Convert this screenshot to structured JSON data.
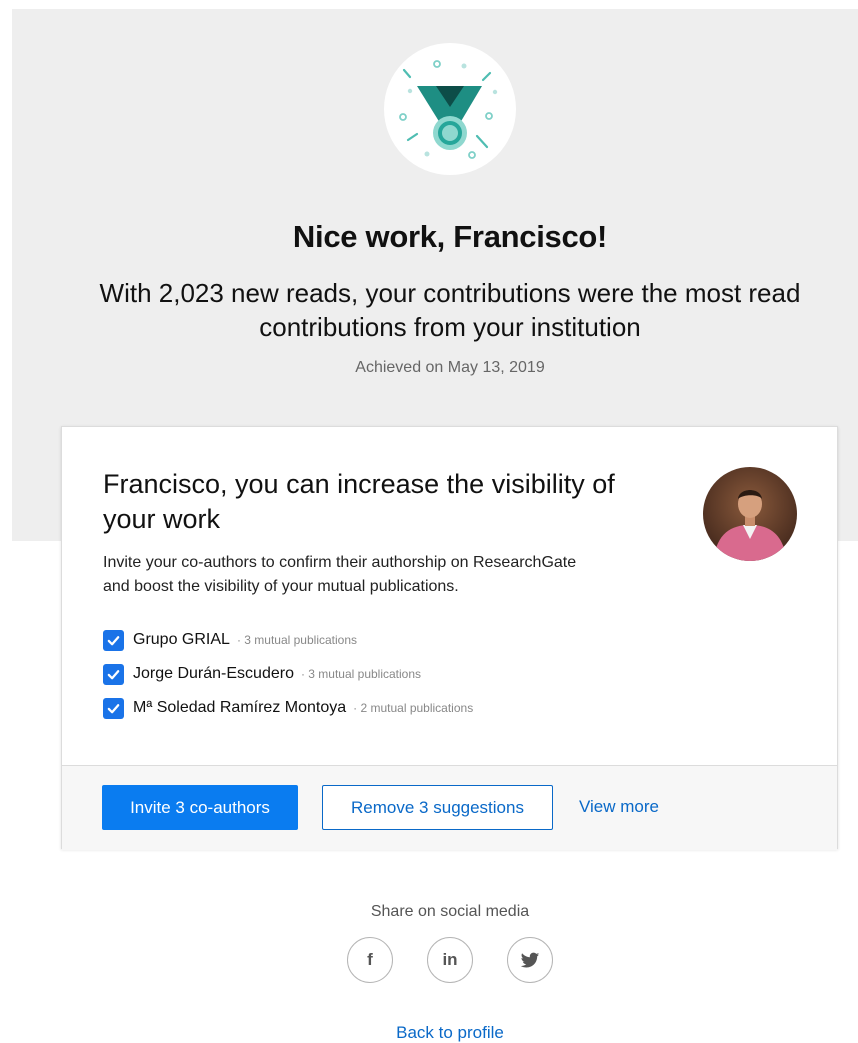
{
  "hero": {
    "headline": "Nice work, Francisco!",
    "subline_line1": "With 2,023 new reads, your contributions were the most read",
    "subline_line2": "contributions from your institution",
    "achieved": "Achieved on May 13, 2019"
  },
  "card": {
    "title_line1": "Francisco, you can increase the visibility of",
    "title_line2": "your work",
    "desc_line1": "Invite your co-authors to confirm their authorship on ResearchGate",
    "desc_line2": "and boost the visibility of your mutual publications.",
    "coauthors": [
      {
        "name": "Grupo GRIAL",
        "meta": "· 3 mutual publications",
        "checked": true
      },
      {
        "name": "Jorge Durán-Escudero",
        "meta": "· 3 mutual publications",
        "checked": true
      },
      {
        "name": "Mª Soledad Ramírez Montoya",
        "meta": "· 2 mutual publications",
        "checked": true
      }
    ],
    "invite_button": "Invite 3 co-authors",
    "remove_button": "Remove 3 suggestions",
    "view_more": "View more"
  },
  "share": {
    "label": "Share on social media",
    "facebook_text": "f",
    "linkedin_text": "in",
    "icons": [
      "facebook-icon",
      "linkedin-icon",
      "twitter-icon"
    ]
  },
  "back_link": "Back to profile",
  "colors": {
    "accent": "#0a7cf0",
    "link": "#0a69c8",
    "medal_teal": "#26a69a",
    "hero_bg": "#eeeeee"
  }
}
